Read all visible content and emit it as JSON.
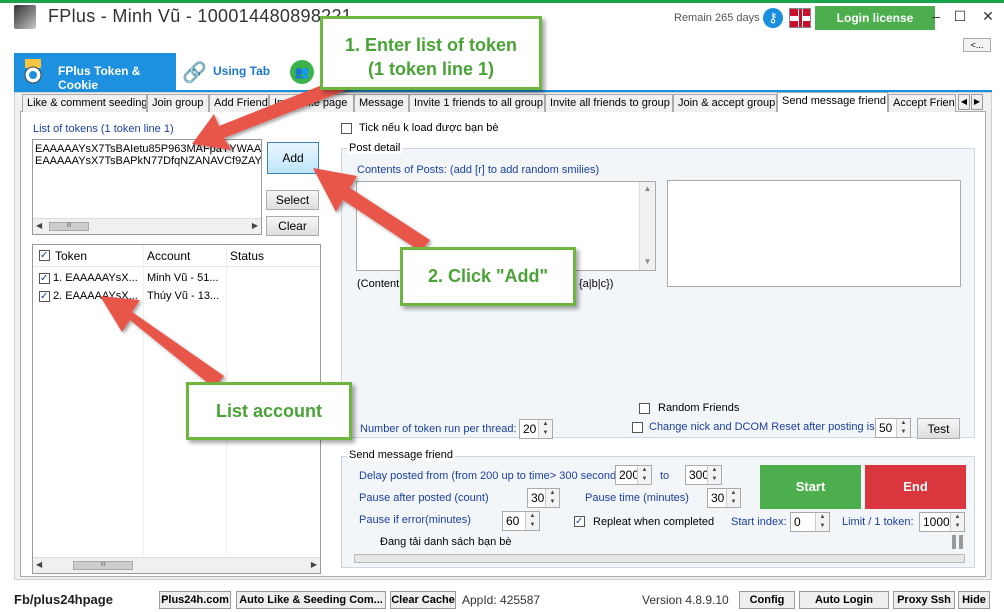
{
  "window": {
    "title": "FPlus - Minh Vũ - 100014480898221",
    "remain": "Remain 265 days",
    "login_license": "Login license",
    "minimize": "–",
    "maximize": "☐",
    "close": "✕",
    "collapse": "<..."
  },
  "top_tabs": [
    {
      "label": "FPlus Token & Cookie",
      "icon": "badge-icon"
    },
    {
      "label": "Using Tab",
      "icon": "link-icon"
    },
    {
      "label": "F",
      "icon": "group-icon"
    }
  ],
  "sub_tabs": [
    "Like & comment seeding",
    "Join group",
    "Add Friend",
    "Invite like page",
    "Message",
    "Invite 1 friends to all group",
    "Invite all friends to group",
    "Join & accept group",
    "Send message friend",
    "Accept Friend"
  ],
  "tokens": {
    "label": "List of tokens (1 token line 1)",
    "lines": "EAAAAAYsX7TsBAIetu85P963MAFpaYYWAAV\nEAAAAAYsX7TsBAPkN77DfqNZANAVCf9ZAYc",
    "scroll_thumb": "III"
  },
  "buttons": {
    "add": "Add",
    "select": "Select",
    "clear": "Clear",
    "test": "Test",
    "start": "Start",
    "end": "End"
  },
  "account_table": {
    "columns": [
      "Token",
      "Account",
      "Status"
    ],
    "rows": [
      {
        "token": "1. EAAAAAYsX...",
        "account": "Minh Vũ - 51..."
      },
      {
        "token": "2. EAAAAAYsX...",
        "account": "Thúy Vũ - 13..."
      }
    ],
    "scroll_thumb": "III"
  },
  "post_detail": {
    "tick_label": "Tick nếu k load được bạn bè",
    "legend": "Post detail",
    "contents_label": "Contents of Posts: (add [r] to add random smilies)",
    "hint_start": "(Content s",
    "hint_end": "{a|b|c})",
    "random_friends": "Random Friends",
    "token_thread_label": "Number of token run per thread:",
    "token_thread_value": "20",
    "change_nick": "Change nick and DCOM Reset after posting is",
    "change_nick_value": "50"
  },
  "send_friend": {
    "legend": "Send message friend",
    "delay_label": "Delay posted from (from 200 up to time> 300 seconds)",
    "delay_from": "200",
    "to_label": "to",
    "delay_to": "300",
    "pause_after_label": "Pause after posted (count)",
    "pause_after": "30",
    "pause_time_label": "Pause time (minutes)",
    "pause_time": "30",
    "pause_error_label": "Pause if error(minutes)",
    "pause_error": "60",
    "repeat_label": "Repleat when completed",
    "start_index_label": "Start index:",
    "start_index": "0",
    "limit_label": "Limit / 1 token:",
    "limit": "1000",
    "loading": "Đang tải danh sách bạn bè"
  },
  "bottom": {
    "fb_page": "Fb/plus24hpage",
    "buttons": [
      "Plus24h.com",
      "Auto Like & Seeding Com...",
      "Clear Cache",
      "Config",
      "Auto Login",
      "Proxy Ssh",
      "Hide"
    ],
    "appid": "AppId: 425587",
    "version": "Version 4.8.9.10"
  },
  "annotations": {
    "callout_1": "1. Enter list of token\n(1 token line 1)",
    "callout_2": "2. Click \"Add\"",
    "callout_3": "List account"
  },
  "colors": {
    "accent_green": "#4cae4c",
    "accent_red": "#d9363e",
    "tab_blue": "#1e90e0",
    "arrow_red": "#e8544a",
    "callout_green": "#6fb63e"
  }
}
